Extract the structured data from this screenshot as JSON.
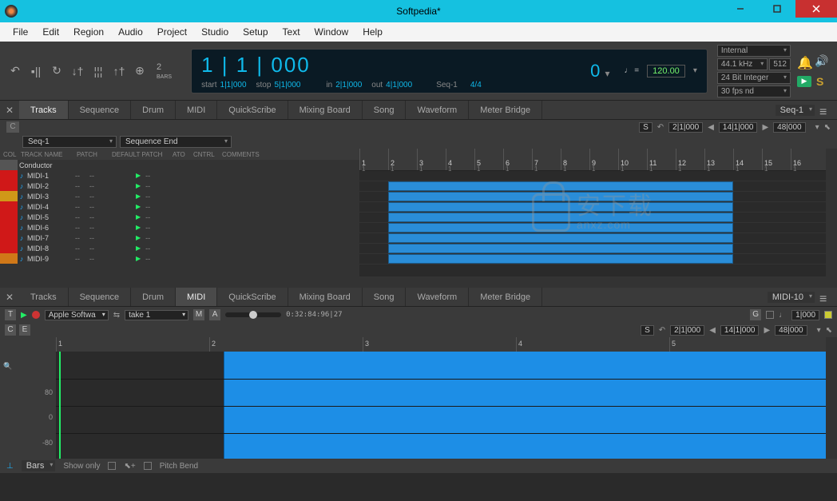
{
  "window": {
    "title": "Softpedia*"
  },
  "menubar": [
    "File",
    "Edit",
    "Region",
    "Audio",
    "Project",
    "Studio",
    "Setup",
    "Text",
    "Window",
    "Help"
  ],
  "transport": {
    "bars_label": "2\nBARS",
    "counter_main": "1 | 1 | 000",
    "start_label": "start",
    "start_val": "1|1|000",
    "stop_label": "stop",
    "stop_val": "5|1|000",
    "in_label": "in",
    "in_val": "2|1|000",
    "out_label": "out",
    "out_val": "4|1|000",
    "seq_label": "Seq-1",
    "timesig": "4/4",
    "counter_right": "0",
    "tempo": "120.00"
  },
  "settings": {
    "clock": "Internal",
    "rate": "44.1 kHz",
    "buffer": "512",
    "bit": "24 Bit Integer",
    "fps": "30 fps nd"
  },
  "viewtabs": [
    "Tracks",
    "Sequence",
    "Drum",
    "MIDI",
    "QuickScribe",
    "Mixing Board",
    "Song",
    "Waveform",
    "Meter Bridge"
  ],
  "viewtabs_right": "Seq-1",
  "locator": {
    "s_label": "S",
    "loc1": "2|1|000",
    "loc2": "14|1|000",
    "loc3": "48|000"
  },
  "seqrow": {
    "seq": "Seq-1",
    "end": "Sequence End"
  },
  "track_cols": [
    "COL",
    "TRACK NAME",
    "PATCH",
    "DEFAULT PATCH",
    "ATO",
    "CNTRL",
    "COMMENTS"
  ],
  "conductor": "Conductor",
  "tracks": [
    {
      "name": "MIDI-1",
      "col": "#d01818"
    },
    {
      "name": "MIDI-2",
      "col": "#d01818"
    },
    {
      "name": "MIDI-3",
      "col": "#d09818"
    },
    {
      "name": "MIDI-4",
      "col": "#d01818"
    },
    {
      "name": "MIDI-5",
      "col": "#d01818"
    },
    {
      "name": "MIDI-6",
      "col": "#d01818"
    },
    {
      "name": "MIDI-7",
      "col": "#d01818"
    },
    {
      "name": "MIDI-8",
      "col": "#d01818"
    },
    {
      "name": "MIDI-9",
      "col": "#d07818"
    }
  ],
  "timeline_bars": [
    1,
    2,
    3,
    4,
    5,
    6,
    7,
    8,
    9,
    10,
    11,
    12,
    13,
    14,
    15,
    16
  ],
  "midi_pane": {
    "tabs_right": "MIDI-10",
    "toolbar": {
      "t": "T",
      "instrument": "Apple Softwa",
      "take": "take 1",
      "m": "M",
      "a": "A",
      "timecode": "0:32:84:96|27",
      "g": "G",
      "pos": "1|000"
    },
    "loc": {
      "c": "C",
      "e": "E",
      "s": "S",
      "loc1": "2|1|000",
      "loc2": "14|1|000",
      "loc3": "48|000"
    },
    "ruler": [
      1,
      2,
      3,
      4,
      5
    ],
    "left_labels": [
      "",
      "80",
      "0",
      "-80"
    ],
    "footer": {
      "bars": "Bars",
      "showonly": "Show only",
      "pitchbend": "Pitch Bend"
    }
  },
  "watermark": {
    "cn": "安下载",
    "url": "anxz.com"
  }
}
